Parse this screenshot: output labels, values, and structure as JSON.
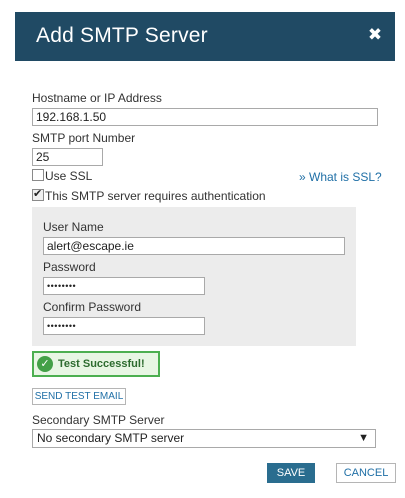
{
  "dialog": {
    "title": "Add SMTP Server",
    "close_glyph": "✖"
  },
  "form": {
    "hostname_label": "Hostname or IP Address",
    "hostname_value": "192.168.1.50",
    "port_label": "SMTP port Number",
    "port_value": "25",
    "use_ssl_label": "Use SSL",
    "use_ssl_checked": false,
    "ssl_help_link": "» What is SSL?",
    "requires_auth_label": "This SMTP server requires authentication",
    "requires_auth_checked": true
  },
  "auth": {
    "username_label": "User Name",
    "username_value": "alert@escape.ie",
    "password_label": "Password",
    "password_value": "••••••••",
    "confirm_label": "Confirm Password",
    "confirm_value": "••••••••"
  },
  "test": {
    "status_icon": "check-circle",
    "status_text": "Test Successful!",
    "send_test_label": "SEND TEST EMAIL"
  },
  "secondary": {
    "label": "Secondary SMTP Server",
    "selected": "No secondary SMTP server",
    "arrow": "▼"
  },
  "footer": {
    "save_label": "SAVE",
    "cancel_label": "CANCEL"
  },
  "colors": {
    "header_bg": "#204a64",
    "accent": "#2a6d8f",
    "link": "#1f6fa6",
    "success": "#4caf50"
  }
}
